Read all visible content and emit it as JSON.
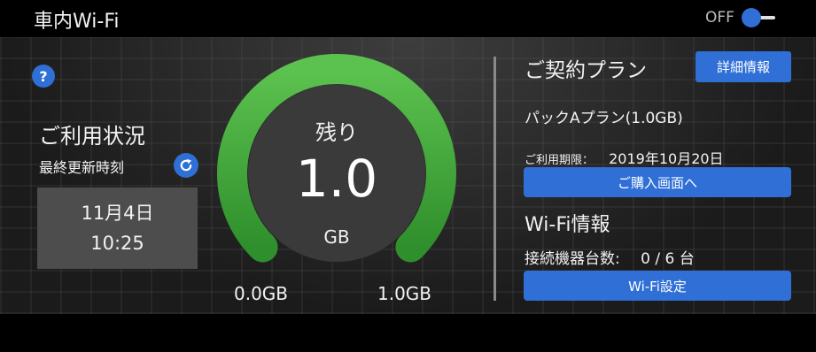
{
  "header": {
    "title": "車内Wi-Fi",
    "toggle_label": "OFF"
  },
  "usage": {
    "help_icon": "?",
    "title": "ご利用状況",
    "last_updated_label": "最終更新時刻",
    "date": "11月4日",
    "time": "10:25"
  },
  "gauge": {
    "remaining_label": "残り",
    "value": "1.0",
    "unit": "GB",
    "min_label": "0.0GB",
    "max_label": "1.0GB",
    "fill_fraction": 1.0
  },
  "plan": {
    "title": "ご契約プラン",
    "details_button": "詳細情報",
    "plan_name": "パックAプラン(1.0GB)",
    "period_label": "ご利用期限：",
    "period_value": "2019年10月20日",
    "purchase_button": "ご購入画面へ"
  },
  "wifi": {
    "title": "Wi-Fi情報",
    "device_count_label": "接続機器台数:",
    "device_count_value": "0 / 6 台",
    "settings_button": "Wi-Fi設定"
  },
  "colors": {
    "accent_blue": "#2f6fd6",
    "gauge_green": "#3fa83a",
    "gauge_center": "#3a3a3a"
  },
  "icons": {
    "help": "question-icon",
    "refresh": "refresh-icon"
  }
}
